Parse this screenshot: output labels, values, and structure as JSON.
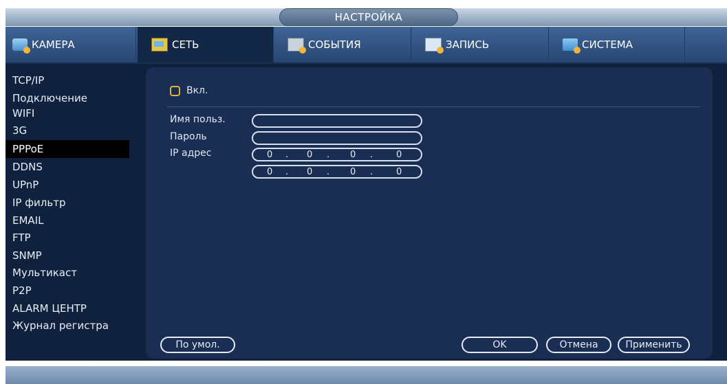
{
  "window": {
    "title": "НАСТРОЙКА"
  },
  "tabs": [
    {
      "label": "КАМЕРА",
      "icon": "camera-icon"
    },
    {
      "label": "СЕТЬ",
      "icon": "network-icon"
    },
    {
      "label": "СОБЫТИЯ",
      "icon": "events-icon"
    },
    {
      "label": "ЗАПИСЬ",
      "icon": "record-icon"
    },
    {
      "label": "СИСТЕМА",
      "icon": "system-icon"
    }
  ],
  "active_tab": "СЕТЬ",
  "sidebar": {
    "items": [
      {
        "label": "TCP/IP"
      },
      {
        "label": "Подключение"
      },
      {
        "label": "WIFI"
      },
      {
        "label": "3G"
      },
      {
        "label": "PPPoE"
      },
      {
        "label": "DDNS"
      },
      {
        "label": "UPnP"
      },
      {
        "label": "IP фильтр"
      },
      {
        "label": "EMAIL"
      },
      {
        "label": "FTP"
      },
      {
        "label": "SNMP"
      },
      {
        "label": "Мультикаст"
      },
      {
        "label": "P2P"
      },
      {
        "label": "ALARM ЦЕНТР"
      },
      {
        "label": "Журнал регистра"
      }
    ],
    "active": "PPPoE"
  },
  "form": {
    "enable_label": "Вкл.",
    "enable_checked": false,
    "username_label": "Имя польз.",
    "username_value": "",
    "password_label": "Пароль",
    "password_value": "",
    "ip_label": "IP адрес",
    "ip1": [
      "0",
      "0",
      "0",
      "0"
    ],
    "ip2": [
      "0",
      "0",
      "0",
      "0"
    ]
  },
  "buttons": {
    "default": "По умол.",
    "ok": "OK",
    "cancel": "Отмена",
    "apply": "Применить"
  },
  "colors": {
    "background": "#10213e",
    "panel": "#1a2d52",
    "accent": "#e2b53a",
    "tabbar": "#274571"
  }
}
